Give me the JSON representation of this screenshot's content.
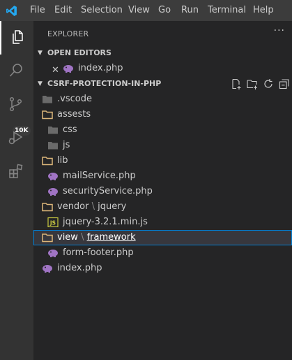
{
  "menu": [
    "File",
    "Edit",
    "Selection",
    "View",
    "Go",
    "Run",
    "Terminal",
    "Help"
  ],
  "activity": {
    "badge": "10K"
  },
  "explorer": {
    "title": "EXPLORER",
    "more": "···",
    "open_editors": {
      "label": "OPEN EDITORS",
      "files": [
        {
          "name": "index.php"
        }
      ]
    },
    "project": {
      "label": "CSRF-PROTECTION-IN-PHP",
      "tree": [
        {
          "name": ".vscode",
          "type": "folder",
          "depth": 0
        },
        {
          "name": "assests",
          "type": "folder",
          "depth": 0
        },
        {
          "name": "css",
          "type": "folder",
          "depth": 1
        },
        {
          "name": "js",
          "type": "folder",
          "depth": 1
        },
        {
          "name": "lib",
          "type": "folder",
          "depth": 0
        },
        {
          "name": "mailService.php",
          "type": "php",
          "depth": 1
        },
        {
          "name": "securityService.php",
          "type": "php",
          "depth": 1
        },
        {
          "name": "vendor",
          "sub": "jquery",
          "type": "folder",
          "depth": 0
        },
        {
          "name": "jquery-3.2.1.min.js",
          "type": "js",
          "depth": 1
        },
        {
          "name": "view",
          "sub": "framework",
          "type": "folder",
          "depth": 0,
          "selected": true
        },
        {
          "name": "form-footer.php",
          "type": "php",
          "depth": 1
        },
        {
          "name": "index.php",
          "type": "php",
          "depth": 0
        }
      ]
    }
  },
  "colors": {
    "titlebar": "#3c3c3c",
    "activity": "#333333",
    "sidebar": "#252526",
    "folder": "#dcb67a",
    "php": "#a074c4",
    "js": "#cbcb41",
    "selection_border": "#007fd4"
  }
}
